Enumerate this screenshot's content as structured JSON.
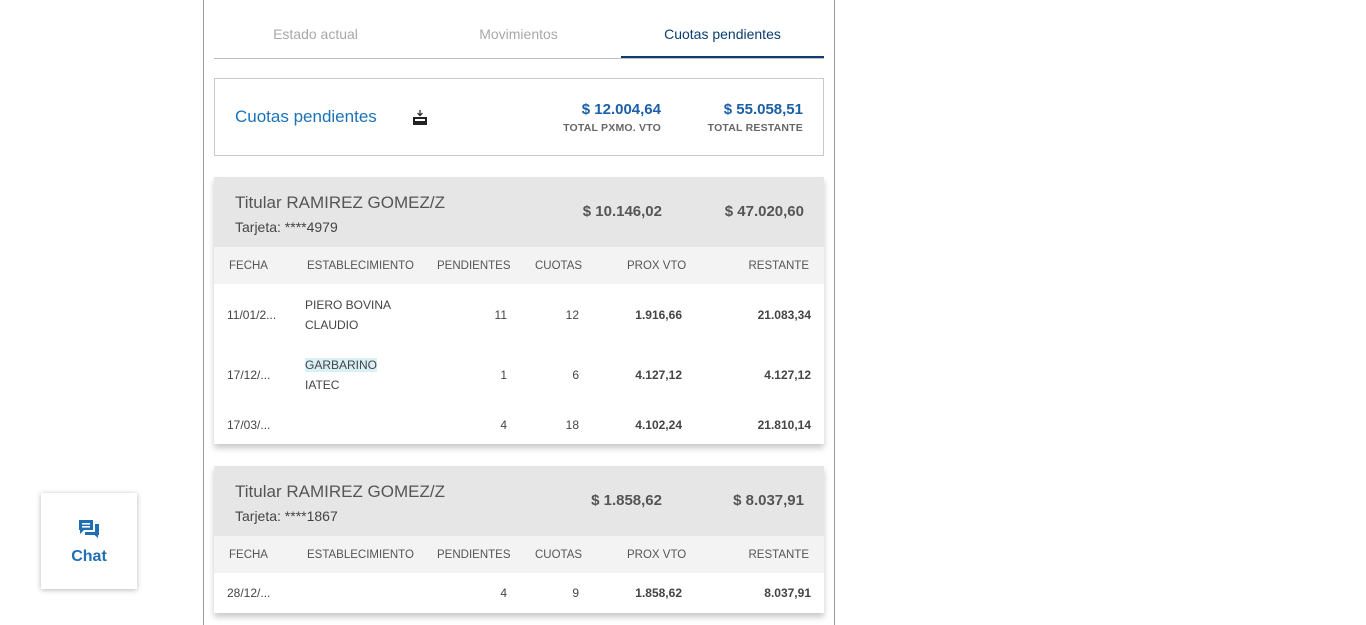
{
  "tabs": [
    {
      "label": "Estado actual"
    },
    {
      "label": "Movimientos"
    },
    {
      "label": "Cuotas pendientes"
    }
  ],
  "summary": {
    "title": "Cuotas pendientes",
    "icon": "download-icon",
    "next_due": {
      "value": "$ 12.004,64",
      "label": "TOTAL PXMO. VTO"
    },
    "remaining": {
      "value": "$ 55.058,51",
      "label": "TOTAL RESTANTE"
    }
  },
  "columns": {
    "fecha": "FECHA",
    "establecimiento": "ESTABLECIMIENTO",
    "pendientes": "PENDIENTES",
    "cuotas": "CUOTAS",
    "prox_vto": "PROX VTO",
    "restante": "RESTANTE"
  },
  "cards": [
    {
      "holder": "Titular RAMIREZ GOMEZ/Z",
      "card_number": "Tarjeta: ****4979",
      "next_due": "$ 10.146,02",
      "remaining": "$ 47.020,60",
      "rows": [
        {
          "fecha": "11/01/2...",
          "est1": "PIERO BOVINA",
          "est2": "CLAUDIO",
          "pendientes": "11",
          "cuotas": "12",
          "prox_vto": "1.916,66",
          "restante": "21.083,34"
        },
        {
          "fecha": "17/12/...",
          "est1": "GARBARINO",
          "est2": "IATEC",
          "pendientes": "1",
          "cuotas": "6",
          "prox_vto": "4.127,12",
          "restante": "4.127,12"
        },
        {
          "fecha": "17/03/...",
          "est1": "",
          "est2": "",
          "pendientes": "4",
          "cuotas": "18",
          "prox_vto": "4.102,24",
          "restante": "21.810,14"
        }
      ]
    },
    {
      "holder": "Titular RAMIREZ GOMEZ/Z",
      "card_number": "Tarjeta: ****1867",
      "next_due": "$ 1.858,62",
      "remaining": "$ 8.037,91",
      "rows": [
        {
          "fecha": "28/12/...",
          "est1": "",
          "est2": "",
          "pendientes": "4",
          "cuotas": "9",
          "prox_vto": "1.858,62",
          "restante": "8.037,91"
        }
      ]
    }
  ],
  "chat": {
    "label": "Chat",
    "icon": "chat-icon"
  }
}
